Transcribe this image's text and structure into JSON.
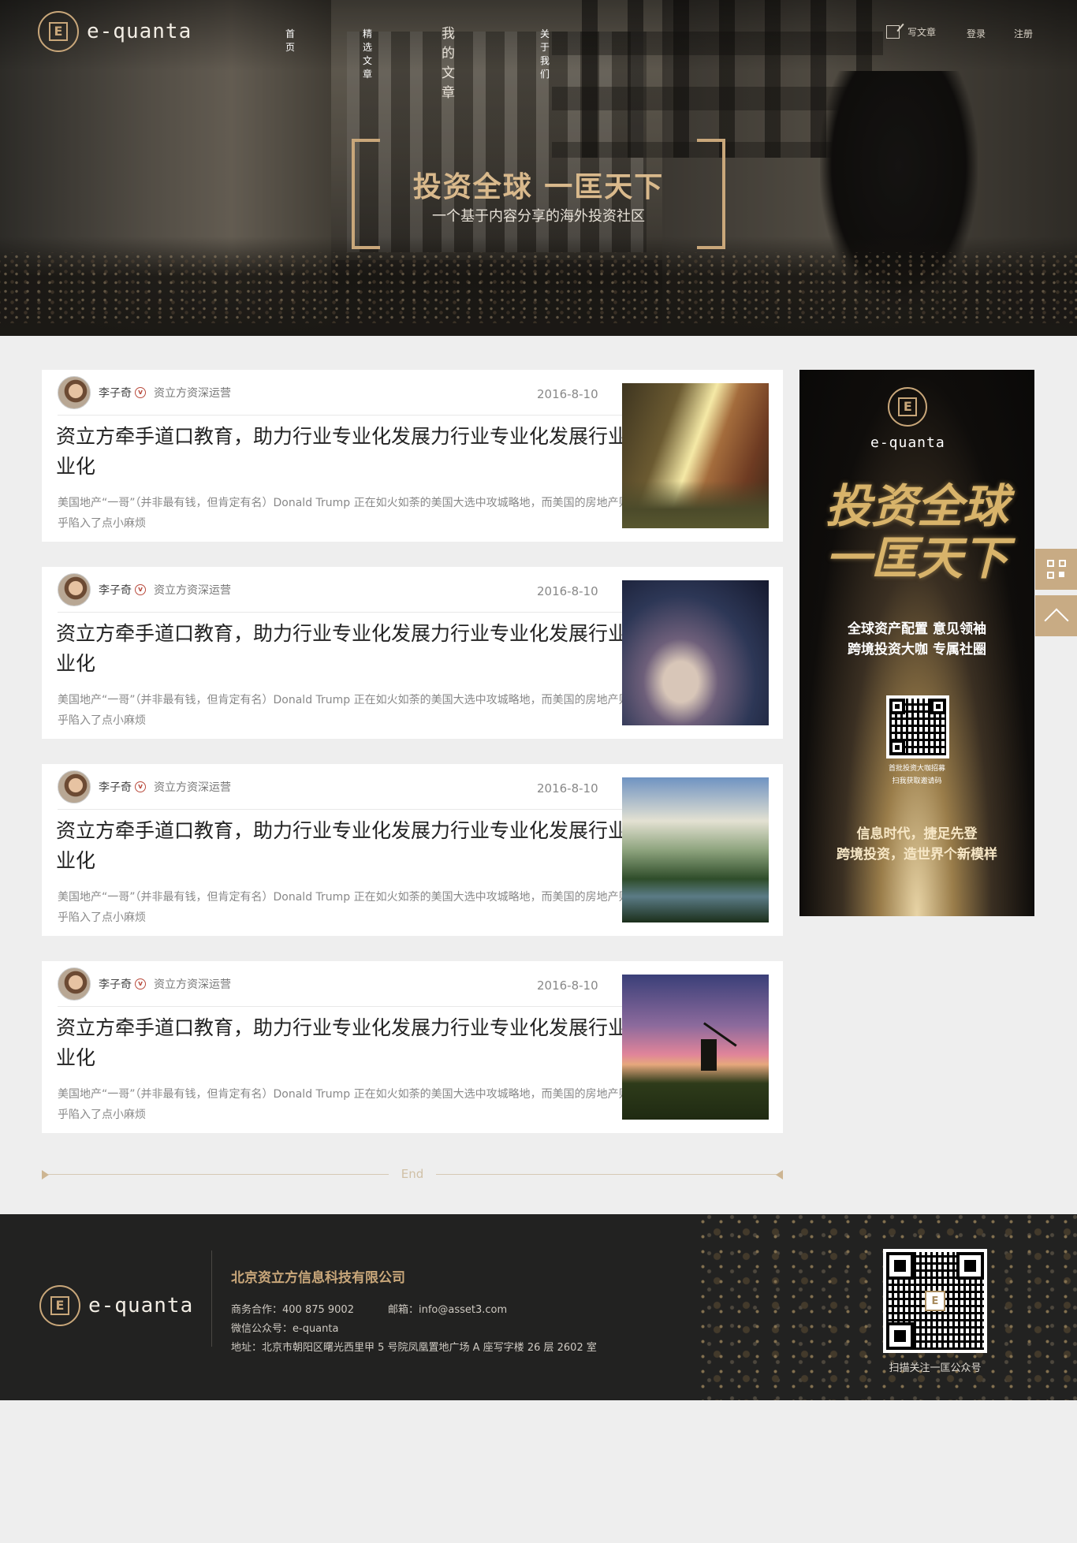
{
  "brand": {
    "name": "e-quanta",
    "logo_glyph": "E"
  },
  "nav": {
    "items": [
      {
        "label": "首页"
      },
      {
        "label": "精选文章"
      },
      {
        "label": "我的文章"
      },
      {
        "label": "关于我们"
      }
    ],
    "write_label": "写文章",
    "login_label": "登录",
    "register_label": "注册"
  },
  "hero": {
    "title": "投资全球  一匡天下",
    "subtitle": "一个基于内容分享的海外投资社区"
  },
  "articles": [
    {
      "author": "李子奇",
      "verified_icon": "v-badge-icon",
      "author_title": "资立方资深运营",
      "date": "2016-8-10",
      "headline": "资立方牵手道口教育，助力行业专业化发展力行业专业化发展行业专业化",
      "excerpt": "美国地产“一哥”（并非最有钱，但肯定有名）Donald Trump 正在如火如荼的美国大选中攻城略地，而美国的房地产则似乎陷入了点小麻烦"
    },
    {
      "author": "李子奇",
      "verified_icon": "v-badge-icon",
      "author_title": "资立方资深运营",
      "date": "2016-8-10",
      "headline": "资立方牵手道口教育，助力行业专业化发展力行业专业化发展行业专业化",
      "excerpt": "美国地产“一哥”（并非最有钱，但肯定有名）Donald Trump 正在如火如荼的美国大选中攻城略地，而美国的房地产则似乎陷入了点小麻烦"
    },
    {
      "author": "李子奇",
      "verified_icon": "v-badge-icon",
      "author_title": "资立方资深运营",
      "date": "2016-8-10",
      "headline": "资立方牵手道口教育，助力行业专业化发展力行业专业化发展行业专业化",
      "excerpt": "美国地产“一哥”（并非最有钱，但肯定有名）Donald Trump 正在如火如荼的美国大选中攻城略地，而美国的房地产则似乎陷入了点小麻烦"
    },
    {
      "author": "李子奇",
      "verified_icon": "v-badge-icon",
      "author_title": "资立方资深运营",
      "date": "2016-8-10",
      "headline": "资立方牵手道口教育，助力行业专业化发展力行业专业化发展行业专业化",
      "excerpt": "美国地产“一哥”（并非最有钱，但肯定有名）Donald Trump 正在如火如荼的美国大选中攻城略地，而美国的房地产则似乎陷入了点小麻烦"
    }
  ],
  "ad": {
    "brush_line1": "投资全球",
    "brush_line2": "一匡天下",
    "slogan_line1": "全球资产配置 意见领袖",
    "slogan_line2": "跨境投资大咖 专属社圈",
    "qr_caption_line1": "首批投资大咖招募",
    "qr_caption_line2": "扫我获取邀请码",
    "tagline_line1": "信息时代，捷足先登",
    "tagline_line2": "跨境投资，造世界个新模样"
  },
  "end_label": "End",
  "footer": {
    "company": "北京资立方信息科技有限公司",
    "business_label": "商务合作：400 875 9002",
    "email_label": "邮箱：info@asset3.com",
    "wechat_label": "微信公众号：e-quanta",
    "address_label": "地址：北京市朝阳区曙光西里甲 5 号院凤凰置地广场 A 座写字楼 26 层 2602 室",
    "qr_caption": "扫描关注一匡公众号"
  },
  "colors": {
    "accent": "#c9a77a",
    "footer_bg": "#222221",
    "page_bg": "#eeeeee",
    "side_button": "#c8ab84"
  }
}
